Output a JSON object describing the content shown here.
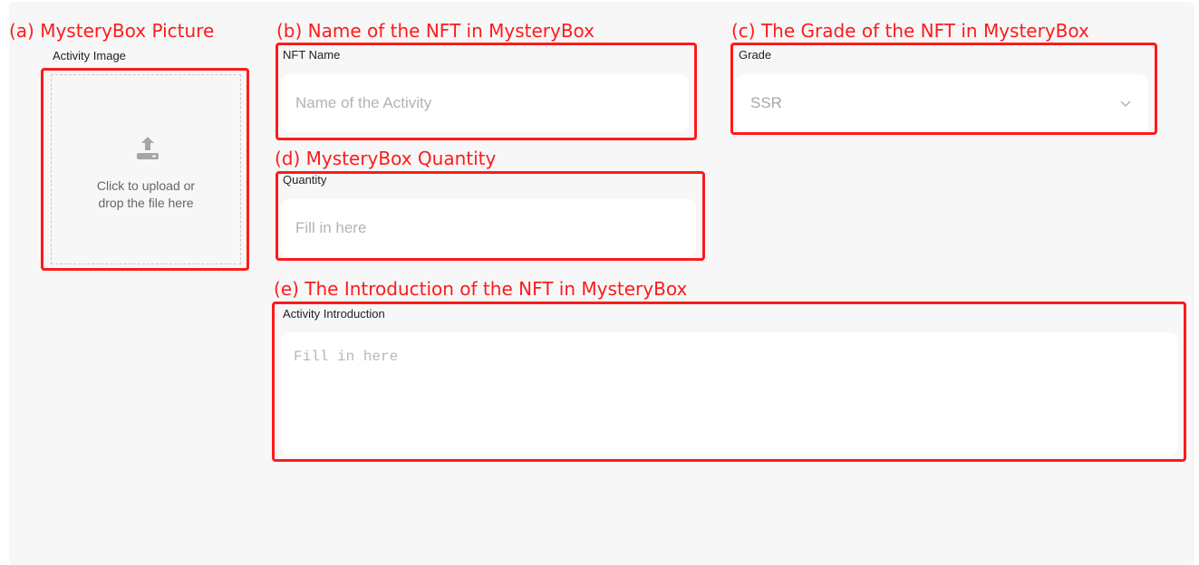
{
  "annotations": {
    "a": "(a) MysteryBox Picture",
    "b": "(b) Name of the NFT in MysteryBox",
    "c": "(c) The Grade of the NFT in MysteryBox",
    "d": "(d) MysteryBox Quantity",
    "e": "(e) The Introduction of the NFT in MysteryBox"
  },
  "form": {
    "activity_image": {
      "label": "Activity Image",
      "upload_line1": "Click to upload or",
      "upload_line2": "drop the file here",
      "icon": "upload-icon"
    },
    "nft_name": {
      "label": "NFT Name",
      "placeholder": "Name of the Activity"
    },
    "grade": {
      "label": "Grade",
      "selected": "SSR",
      "icon": "chevron-down-icon"
    },
    "quantity": {
      "label": "Quantity",
      "placeholder": "Fill in here"
    },
    "introduction": {
      "label": "Activity Introduction",
      "placeholder": "Fill in here"
    }
  },
  "colors": {
    "annotation": "#ff1a1a",
    "panel_background": "#f7f7f8",
    "field_background": "#ffffff",
    "placeholder_text": "#b3b3b3"
  }
}
